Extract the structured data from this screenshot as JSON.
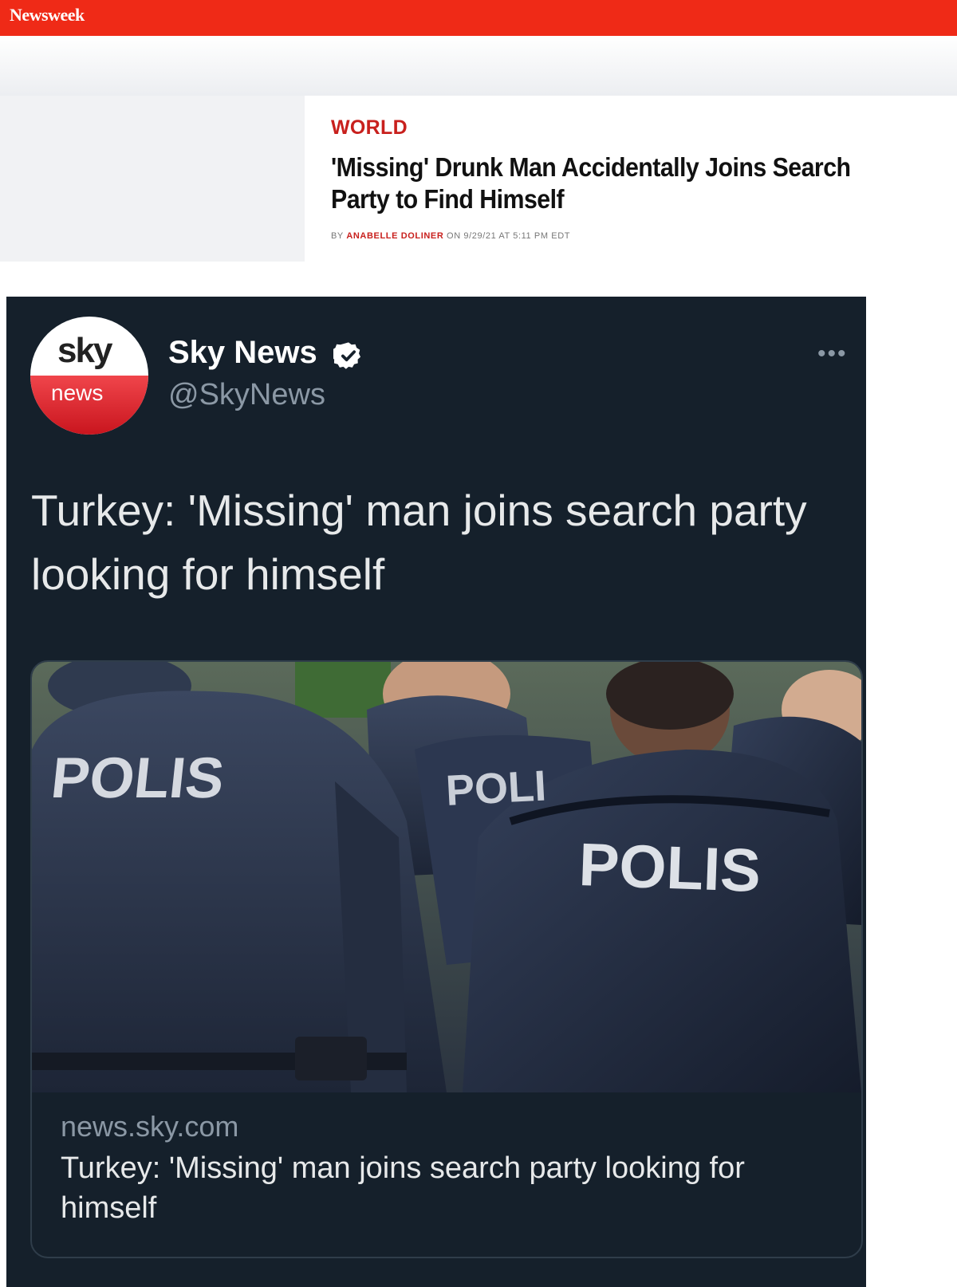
{
  "newsweek": {
    "logo": "Newsweek",
    "section": "WORLD",
    "headline": "'Missing' Drunk Man Accidentally Joins Search Party to Find Himself",
    "byline_prefix": "BY ",
    "author": "ANABELLE DOLINER",
    "byline_suffix": " ON 9/29/21 AT 5:11 PM EDT"
  },
  "tweet": {
    "avatar_top": "sky",
    "avatar_bottom": "news",
    "name": "Sky News",
    "handle": "@SkyNews",
    "more": "•••",
    "text": "Turkey: 'Missing' man joins search party looking for himself",
    "card": {
      "image_labels": [
        "POLIS",
        "POLI",
        "POLIS"
      ],
      "domain": "news.sky.com",
      "title": "Turkey: 'Missing' man joins search party looking for himself"
    }
  },
  "colors": {
    "newsweek_red": "#ef2a17",
    "tweet_bg": "#15202b",
    "verified_blue": "#ffffff"
  }
}
